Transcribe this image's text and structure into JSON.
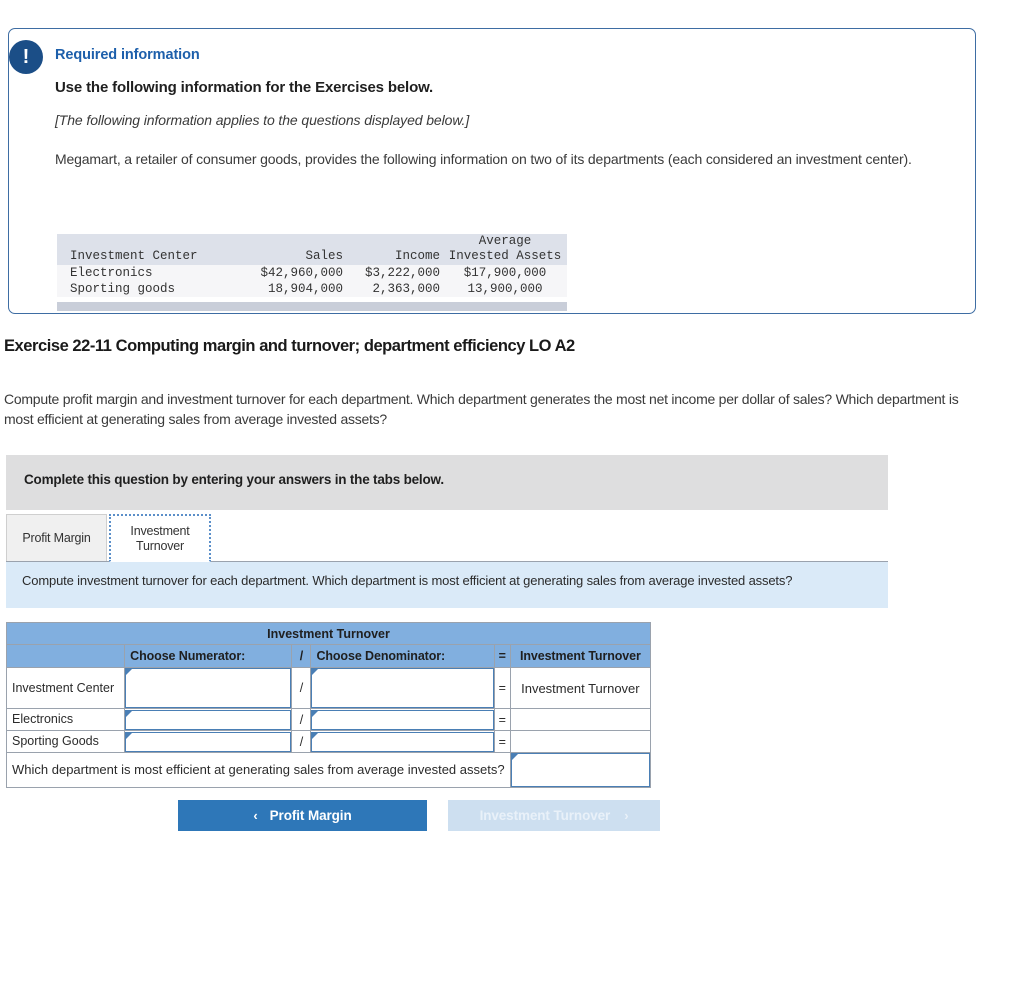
{
  "required_info": {
    "badge_icon": "exclamation-icon",
    "badge_glyph": "!",
    "title": "Required information",
    "subtitle": "Use the following information for the Exercises below.",
    "applies_note": "[The following information applies to the questions displayed below.]",
    "body": "Megamart, a retailer of consumer goods, provides the following information on two of its departments (each considered an investment center)."
  },
  "data_table": {
    "header_top": [
      "",
      "",
      "",
      "Average"
    ],
    "header_bottom": [
      "Investment Center",
      "Sales",
      "Income",
      "Invested Assets"
    ],
    "rows": [
      {
        "center": "Electronics",
        "sales": "$42,960,000",
        "income": "$3,222,000",
        "avg_invested_assets": "$17,900,000"
      },
      {
        "center": "Sporting goods",
        "sales": "18,904,000",
        "income": "2,363,000",
        "avg_invested_assets": "13,900,000"
      }
    ]
  },
  "exercise": {
    "title": "Exercise 22-11 Computing margin and turnover; department efficiency LO A2",
    "prompt": "Compute profit margin and investment turnover for each department. Which department generates the most net income per dollar of sales? Which department is most efficient at generating sales from average invested assets?"
  },
  "instruction_bar": {
    "text": "Complete this question by entering your answers in the tabs below."
  },
  "tabs": [
    {
      "label": "Profit Margin",
      "active": false
    },
    {
      "label": "Investment Turnover",
      "active": true
    }
  ],
  "question_bar": {
    "text": "Compute investment turnover for each department. Which department is most efficient at generating sales from average invested assets?"
  },
  "answer_grid": {
    "title": "Investment Turnover",
    "columns": {
      "label": "",
      "numerator": "Choose Numerator:",
      "slash": "/",
      "denominator": "Choose Denominator:",
      "equals": "=",
      "result": "Investment Turnover"
    },
    "rows": [
      {
        "label": "Investment Center",
        "numerator": "",
        "slash": "/",
        "denominator": "",
        "equals": "=",
        "result": "Investment Turnover"
      },
      {
        "label": "Electronics",
        "numerator": "",
        "slash": "/",
        "denominator": "",
        "equals": "=",
        "result": ""
      },
      {
        "label": "Sporting Goods",
        "numerator": "",
        "slash": "/",
        "denominator": "",
        "equals": "=",
        "result": ""
      }
    ],
    "footer_question": "Which department is most efficient at generating sales from average invested assets?",
    "footer_answer": ""
  },
  "nav": {
    "prev_label": "Profit Margin",
    "prev_chevron": "‹",
    "next_label": "Investment Turnover",
    "next_chevron": "›",
    "next_disabled": true
  },
  "colors": {
    "card_border": "#3e6da3",
    "badge_bg": "#1b4e87",
    "title_blue": "#1d5fab",
    "grid_header_blue": "#81afdf",
    "question_bar_blue": "#daeaf8",
    "instruction_gray": "#dededf",
    "button_active": "#2e77b8",
    "button_disabled": "#cddff0",
    "input_border": "#4a7fb5"
  }
}
